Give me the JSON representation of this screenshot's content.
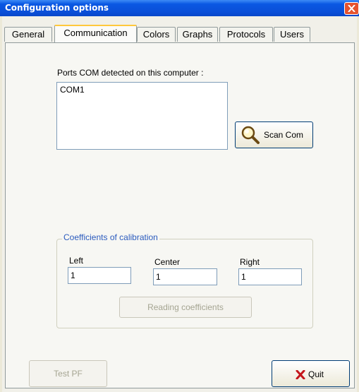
{
  "window": {
    "title": "Configuration options"
  },
  "tabs": [
    {
      "label": "General"
    },
    {
      "label": "Communication"
    },
    {
      "label": "Colors"
    },
    {
      "label": "Graphs"
    },
    {
      "label": "Protocols"
    },
    {
      "label": "Users"
    }
  ],
  "communication": {
    "ports_label": "Ports COM detected on this computer :",
    "ports": [
      "COM1"
    ],
    "scan_button": "Scan Com"
  },
  "calibration": {
    "group_title": "Coefficients of calibration",
    "left_label": "Left",
    "center_label": "Center",
    "right_label": "Right",
    "left_value": "1",
    "center_value": "1",
    "right_value": "1",
    "read_button": "Reading coefficients"
  },
  "footer": {
    "test_button": "Test PF",
    "quit_button": "Quit"
  }
}
